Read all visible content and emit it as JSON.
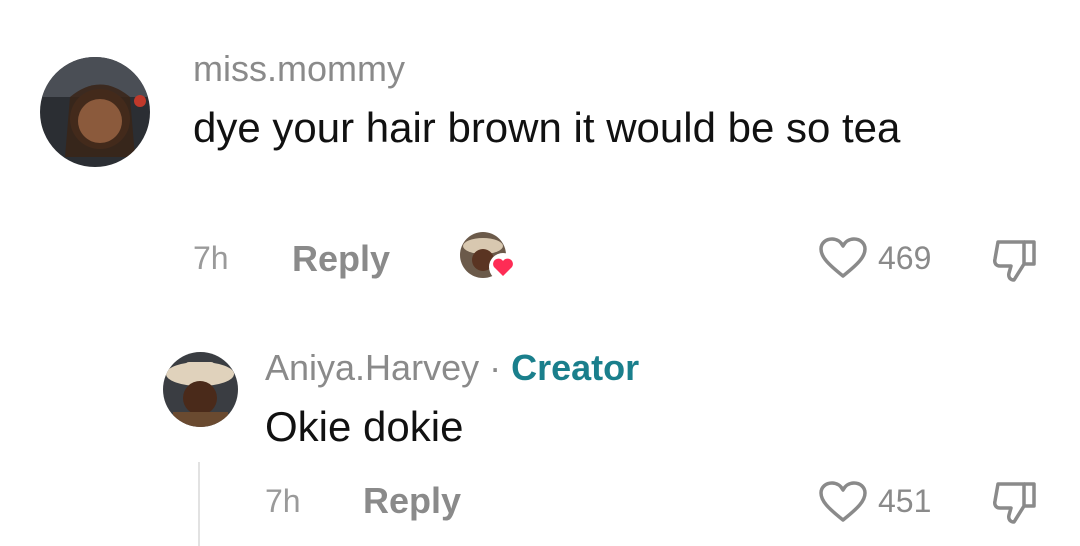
{
  "comment": {
    "username": "miss.mommy",
    "text": "dye your hair brown it would be so tea",
    "time": "7h",
    "reply_label": "Reply",
    "likes": "469"
  },
  "reply": {
    "username": "Aniya.Harvey",
    "separator": "·",
    "creator_label": "Creator",
    "text": "Okie dokie",
    "time": "7h",
    "reply_label": "Reply",
    "likes": "451"
  },
  "colors": {
    "creator_accent": "#1a7f8c",
    "creator_like_heart": "#fe2c55",
    "muted_text": "#8a8a8a"
  },
  "icons": [
    "heart-outline-icon",
    "thumbs-down-icon",
    "creator-liked-badge-icon"
  ]
}
